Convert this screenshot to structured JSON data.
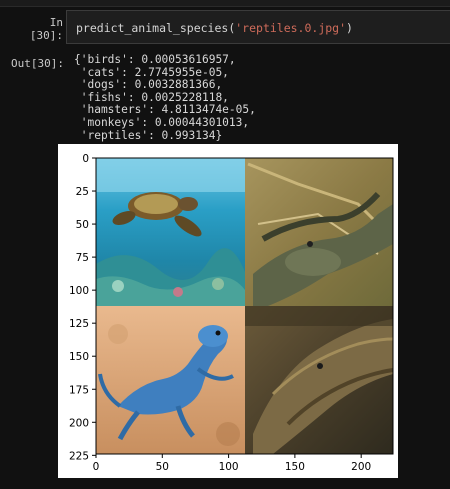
{
  "cell": {
    "in_prompt": "In [30]:",
    "code_fn": "predict_animal_species(",
    "code_arg": "'reptiles.0.jpg'",
    "code_close": ")"
  },
  "output": {
    "out_prompt": "Out[30]:",
    "lines": [
      "{'birds': 0.00053616957,",
      " 'cats': 2.7745955e-05,",
      " 'dogs': 0.0032881366,",
      " 'fishs': 0.0025228118,",
      " 'hamsters': 4.8113474e-05,",
      " 'monkeys': 0.00044301013,",
      " 'reptiles': 0.993134}"
    ]
  },
  "plot": {
    "y_ticks": [
      "0",
      "25",
      "50",
      "75",
      "100",
      "125",
      "150",
      "175",
      "200",
      "225"
    ],
    "x_ticks": [
      "0",
      "50",
      "100",
      "150",
      "200"
    ],
    "xlim": [
      0,
      224
    ],
    "ylim": [
      224,
      0
    ],
    "image_panels": [
      "sea-turtle-photo",
      "crocodile-top-right-photo",
      "blue-lizard-photo",
      "crocodile-bottom-right-photo"
    ]
  }
}
